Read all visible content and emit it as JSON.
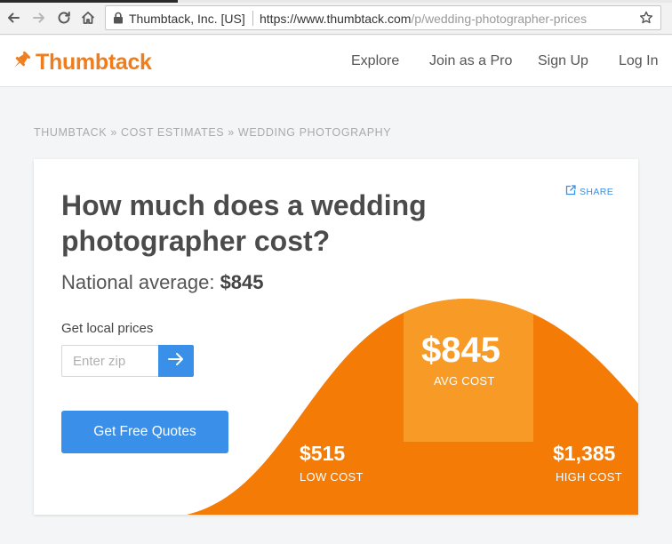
{
  "browser": {
    "site_identity": "Thumbtack, Inc. [US]",
    "url_base": "https://www.thumbtack.com",
    "url_path": "/p/wedding-photographer-prices"
  },
  "header": {
    "brand": "Thumbtack",
    "nav": [
      "Explore",
      "Join as a Pro",
      "Sign Up",
      "Log In"
    ]
  },
  "breadcrumb": {
    "text": "THUMBTACK » COST ESTIMATES » WEDDING PHOTOGRAPHY"
  },
  "card": {
    "share_label": "SHARE",
    "headline": "How much does a wedding photographer cost?",
    "national_label": "National average: ",
    "national_value": "$845",
    "local_label": "Get local prices",
    "zip_placeholder": "Enter zip",
    "cta_label": "Get Free Quotes"
  },
  "cost": {
    "low_value": "$515",
    "low_label": "LOW COST",
    "avg_value": "$845",
    "avg_label": "AVG COST",
    "high_value": "$1,385",
    "high_label": "HIGH COST"
  },
  "colors": {
    "brand_orange": "#ef7d1e",
    "curve_orange": "#f47c06",
    "highlight_orange": "#f9a531",
    "action_blue": "#3a8fe8"
  },
  "icons": {
    "back": "back-arrow-icon",
    "forward": "forward-arrow-icon",
    "reload": "reload-icon",
    "home": "home-icon",
    "lock": "lock-icon",
    "bookmark": "star-icon",
    "logo": "thumbtack-pin-icon",
    "share": "share-icon",
    "submit": "arrow-right-icon"
  }
}
